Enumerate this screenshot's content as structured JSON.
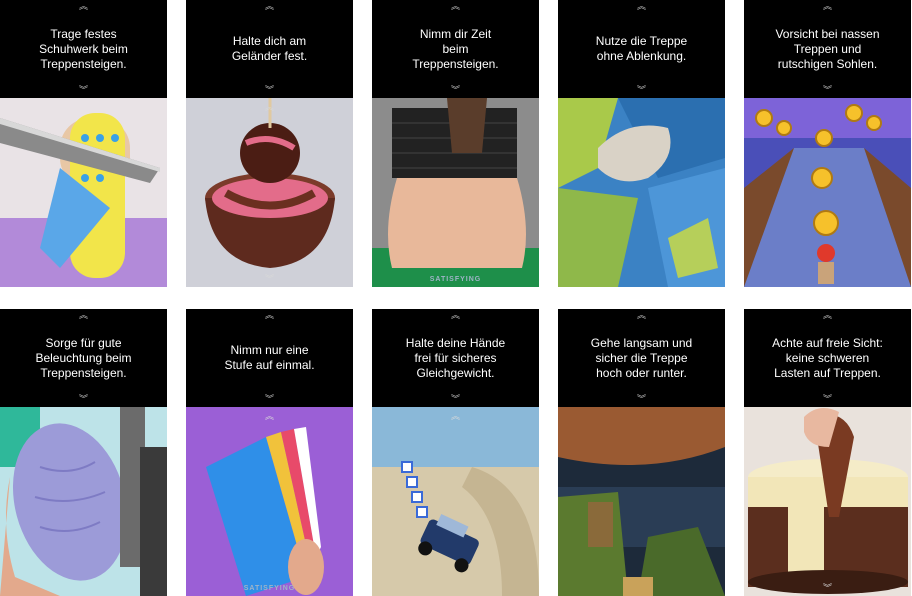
{
  "cards": [
    {
      "caption": "Trage festes\nSchuhwerk beim\nTreppensteigen.",
      "watermark": ""
    },
    {
      "caption": "Halte dich am\nGeländer fest.",
      "watermark": ""
    },
    {
      "caption": "Nimm dir Zeit\nbeim\nTreppensteigen.",
      "watermark": "SATISFYING"
    },
    {
      "caption": "Nutze die Treppe\nohne Ablenkung.",
      "watermark": ""
    },
    {
      "caption": "Vorsicht bei nassen\nTreppen und\nrutschigen Sohlen.",
      "watermark": ""
    },
    {
      "caption": "Sorge für gute\nBeleuchtung beim\nTreppensteigen.",
      "watermark": ""
    },
    {
      "caption": "Nimm nur eine\nStufe auf einmal.",
      "watermark": "SATISFYING"
    },
    {
      "caption": "Halte deine Hände\nfrei für sicheres\nGleichgewicht.",
      "watermark": ""
    },
    {
      "caption": "Gehe langsam und\nsicher die Treppe\nhoch oder runter.",
      "watermark": ""
    },
    {
      "caption": "Achte auf freie Sicht:\nkeine schweren\nLasten auf Treppen.",
      "watermark": ""
    }
  ],
  "icons": {
    "chevron": "double-chevron-icon"
  }
}
